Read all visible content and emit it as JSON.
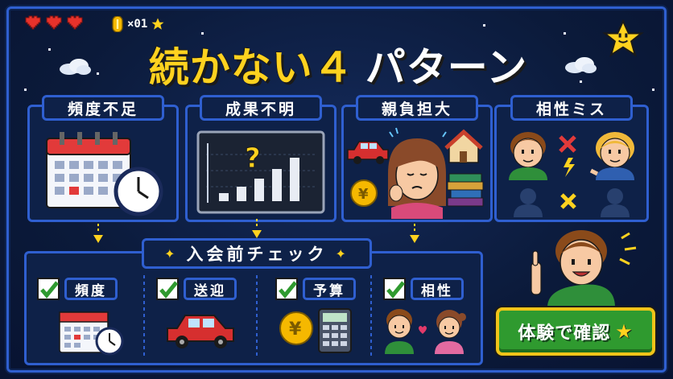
{
  "hud": {
    "lives": 3,
    "coin_count": "×01",
    "heart_color": "#e8322b",
    "coin_color": "#f5b800"
  },
  "title": {
    "main": "続かない４",
    "suffix": "パターン"
  },
  "patterns": [
    {
      "label": "頻度不足",
      "icon": "calendar-clock-icon"
    },
    {
      "label": "成果不明",
      "icon": "question-chart-icon"
    },
    {
      "label": "親負担大",
      "icon": "tired-parent-icon"
    },
    {
      "label": "相性ミス",
      "icon": "mismatch-icon"
    }
  ],
  "check_section": {
    "title": "入会前チェック",
    "items": [
      {
        "label": "頻度",
        "icon": "calendar-clock-icon",
        "checked": true
      },
      {
        "label": "送迎",
        "icon": "car-icon",
        "checked": true
      },
      {
        "label": "予算",
        "icon": "yen-calculator-icon",
        "checked": true
      },
      {
        "label": "相性",
        "icon": "kids-heart-icon",
        "checked": true
      }
    ]
  },
  "cta": {
    "label": "体験で確認",
    "star": "★",
    "color": "#2f9a2f"
  },
  "colors": {
    "accent": "#ffd21f",
    "frame": "#2f5fd0",
    "background": "#0b1a3a"
  }
}
